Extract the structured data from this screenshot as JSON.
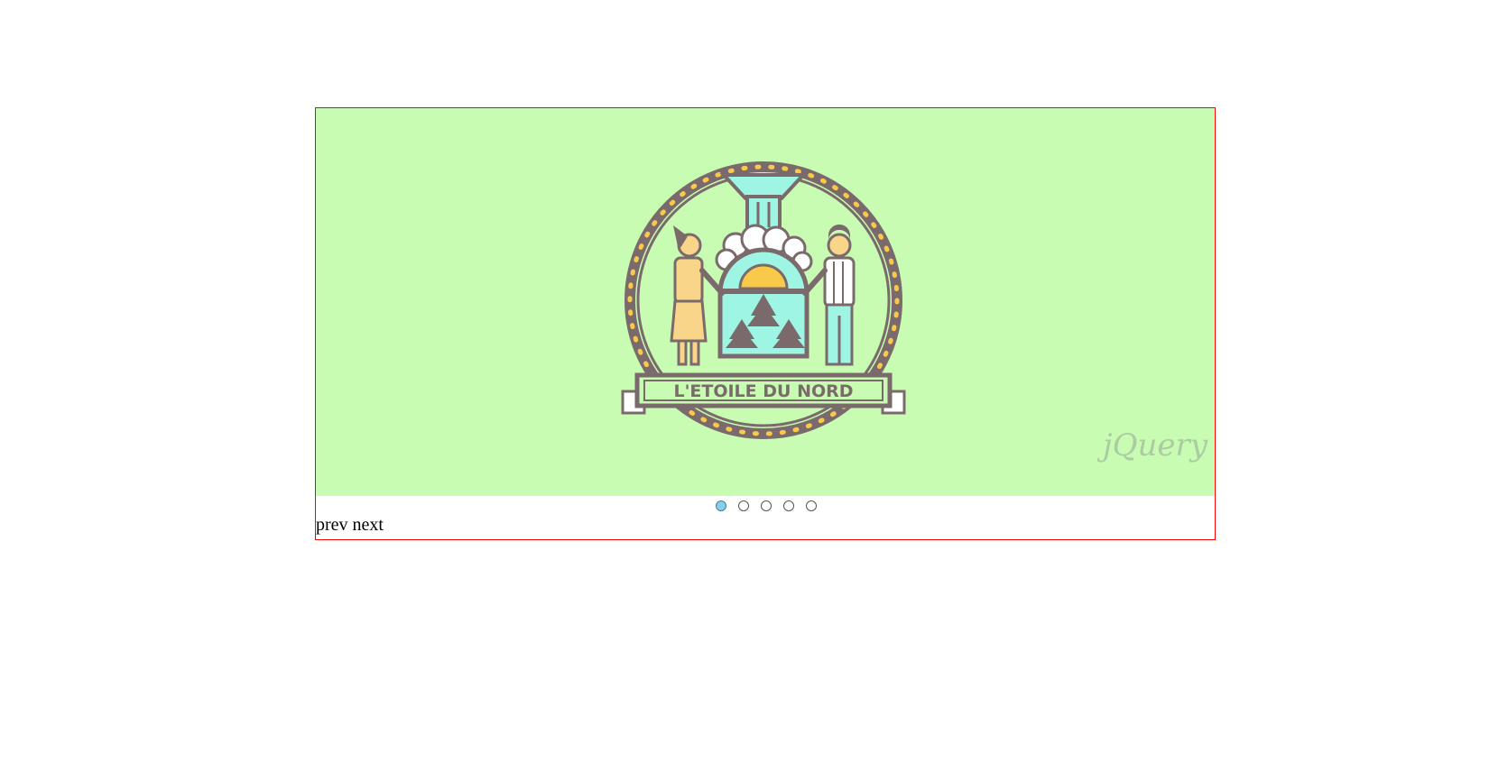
{
  "slider": {
    "slide": {
      "background": "#c8fcb2",
      "badge_text": "L'ETOILE DU NORD",
      "watermark": "jQuery"
    },
    "dots": [
      {
        "active": true
      },
      {
        "active": false
      },
      {
        "active": false
      },
      {
        "active": false
      },
      {
        "active": false
      }
    ],
    "prev_label": "prev",
    "next_label": "next"
  },
  "colors": {
    "border": "#ff0000",
    "active_dot": "#87ceeb",
    "badge_outline": "#7b6a6c",
    "badge_gold": "#f9c94a",
    "badge_mint": "#9ef5e3"
  }
}
